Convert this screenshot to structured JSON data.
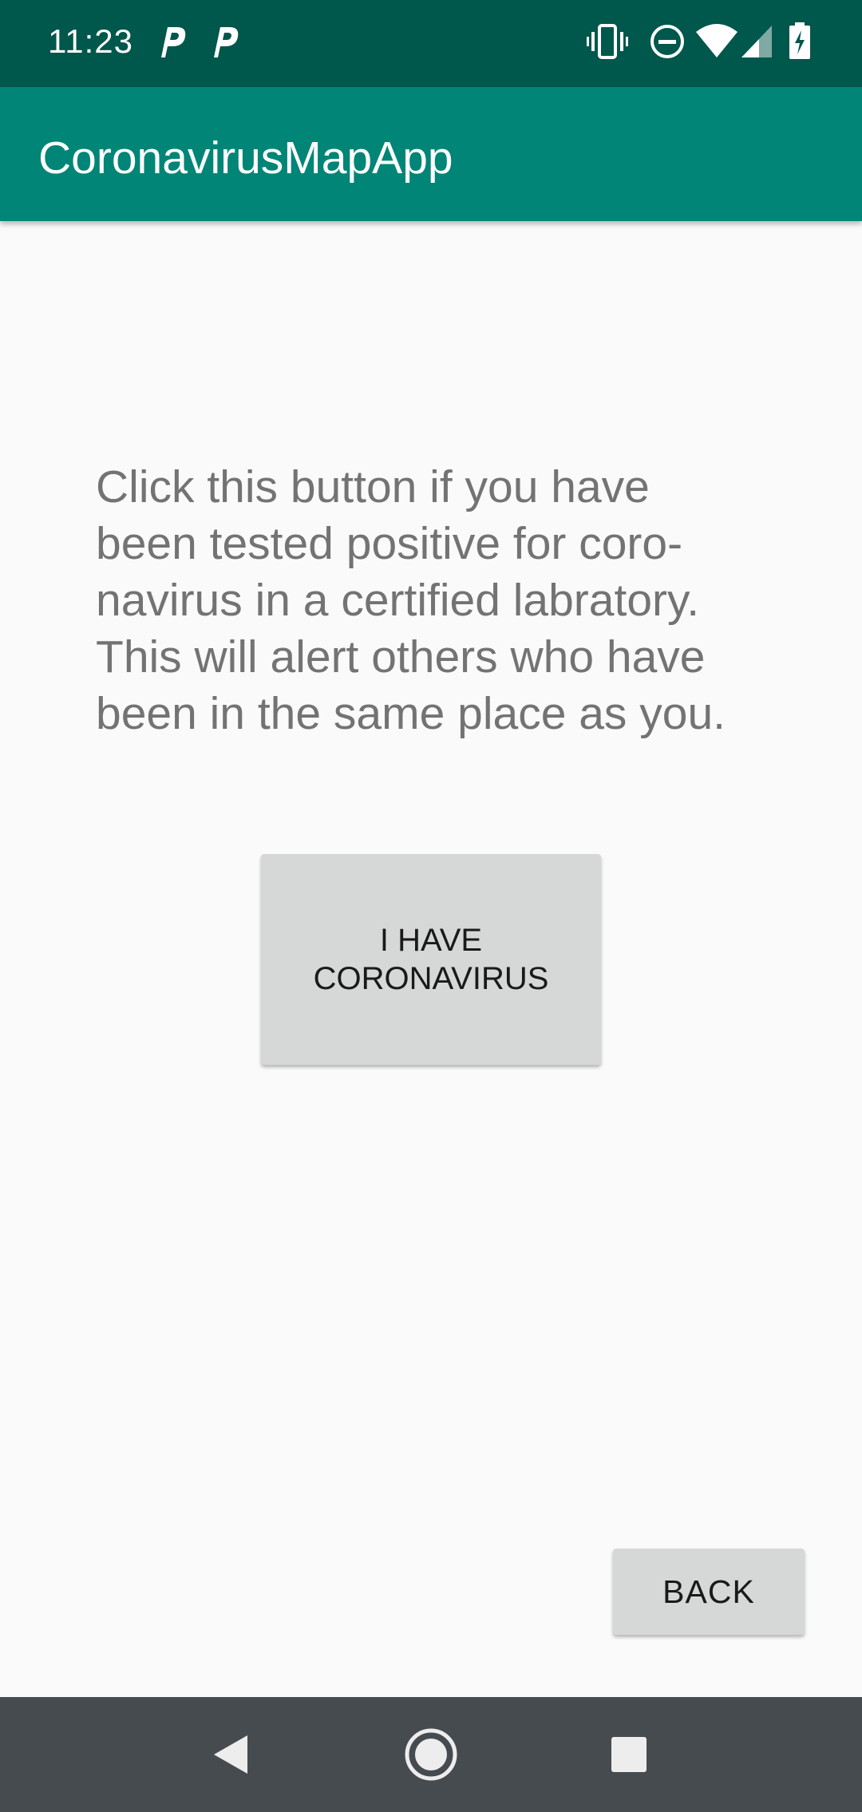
{
  "status_bar": {
    "time": "11:23",
    "notification_icons": [
      "parking-icon",
      "parking-icon"
    ],
    "system_icons": [
      "vibrate-icon",
      "do-not-disturb-icon",
      "wifi-icon",
      "cell-signal-icon",
      "battery-charging-icon"
    ]
  },
  "app_bar": {
    "title": "CoronavirusMapApp"
  },
  "main": {
    "info_text": "Click this button if you have\nbeen tested positive for coro-\nnavirus in a certified labratory.\nThis will alert others who have\nbeen in the same place as you.",
    "report_button_label": "I HAVE\nCORONAVIRUS",
    "back_button_label": "BACK"
  },
  "nav_bar": {
    "buttons": [
      "back-icon",
      "home-icon",
      "recents-icon"
    ]
  },
  "colors": {
    "status_bar": "#00574b",
    "app_bar": "#008577",
    "background": "#fafafa",
    "button": "#d6d7d7",
    "nav_bar": "#464b50",
    "text_secondary": "#737373"
  }
}
